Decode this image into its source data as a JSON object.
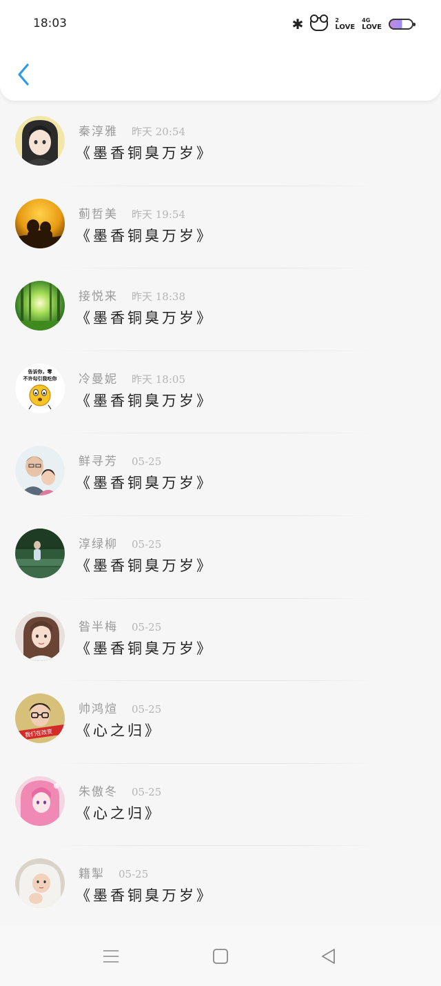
{
  "status_bar": {
    "time": "18:03",
    "bluetooth": "✱",
    "love_label": "LOVE",
    "love_sup": "2",
    "network_label": "LOVE",
    "network_sup": "4G",
    "battery_level": 0.55
  },
  "colors": {
    "back_arrow": "#2b9be8",
    "name_text": "#9a9a9a",
    "title_text": "#222222"
  },
  "header": {
    "back_icon": "chevron-left-icon"
  },
  "items": [
    {
      "name": "秦淳雅",
      "time": "昨天 20:54",
      "title": "《墨香铜臭万岁》",
      "avatar": "anime-girl-avatar"
    },
    {
      "name": "蓟哲美",
      "time": "昨天 19:54",
      "title": "《墨香铜臭万岁》",
      "avatar": "sunset-couple-avatar"
    },
    {
      "name": "接悦来",
      "time": "昨天 18:38",
      "title": "《墨香铜臭万岁》",
      "avatar": "forest-sunlight-avatar"
    },
    {
      "name": "冷曼妮",
      "time": "昨天 18:05",
      "title": "《墨香铜臭万岁》",
      "avatar": "emoji-meme-avatar"
    },
    {
      "name": "鲜寻芳",
      "time": "05-25",
      "title": "《墨香铜臭万岁》",
      "avatar": "father-child-avatar"
    },
    {
      "name": "淳绿柳",
      "time": "05-25",
      "title": "《墨香铜臭万岁》",
      "avatar": "green-scene-avatar"
    },
    {
      "name": "昝半梅",
      "time": "05-25",
      "title": "《墨香铜臭万岁》",
      "avatar": "girl-photo-avatar"
    },
    {
      "name": "帅鸿煊",
      "time": "05-25",
      "title": "《心之归》",
      "avatar": "glasses-boy-avatar"
    },
    {
      "name": "朱傲冬",
      "time": "05-25",
      "title": "《心之归》",
      "avatar": "pink-anime-avatar"
    },
    {
      "name": "籍掣",
      "time": "05-25",
      "title": "《墨香铜臭万岁》",
      "avatar": "baby-avatar"
    }
  ],
  "meme_text": [
    "告诉你，零",
    "不许勾引我吃你"
  ],
  "avatar8_banner": "我们在改变",
  "nav": {
    "menu_icon": "menu-icon",
    "home_icon": "home-square-icon",
    "back_icon": "back-triangle-icon"
  }
}
